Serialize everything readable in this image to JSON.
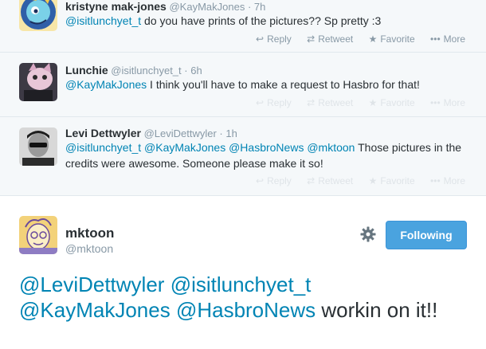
{
  "colors": {
    "link": "#0084b4",
    "muted": "#8899a6",
    "follow_button": "#4aa3df",
    "reply_background": "#f5f8fa"
  },
  "replies": [
    {
      "fullname": "kristyne mak-jones",
      "username": "@KayMakJones",
      "dot": "·",
      "time": "7h",
      "mentions": [
        "@isitlunchyet_t"
      ],
      "text": " do you have prints of the pictures?? Sp pretty :3",
      "actions": {
        "reply": "Reply",
        "retweet": "Retweet",
        "favorite": "Favorite",
        "more": "More"
      }
    },
    {
      "fullname": "Lunchie",
      "username": "@isitlunchyet_t",
      "dot": "·",
      "time": "6h",
      "mentions": [
        "@KayMakJones"
      ],
      "text": " I think you'll have to make a request to Hasbro for that!",
      "actions": {
        "reply": "Reply",
        "retweet": "Retweet",
        "favorite": "Favorite",
        "more": "More"
      }
    },
    {
      "fullname": "Levi Dettwyler",
      "username": "@LeviDettwyler",
      "dot": "·",
      "time": "1h",
      "mentions": [
        "@isitlunchyet_t",
        "@KayMakJones",
        "@HasbroNews",
        "@mktoon"
      ],
      "text": " Those pictures in the credits were awesome. Someone please make it so!",
      "actions": {
        "reply": "Reply",
        "retweet": "Retweet",
        "favorite": "Favorite",
        "more": "More"
      }
    }
  ],
  "main_tweet": {
    "fullname": "mktoon",
    "username": "@mktoon",
    "follow_label": "Following",
    "mentions": [
      "@LeviDettwyler",
      "@isitlunchyet_t",
      "@KayMakJones",
      "@HasbroNews"
    ],
    "text": " workin on it!!"
  }
}
